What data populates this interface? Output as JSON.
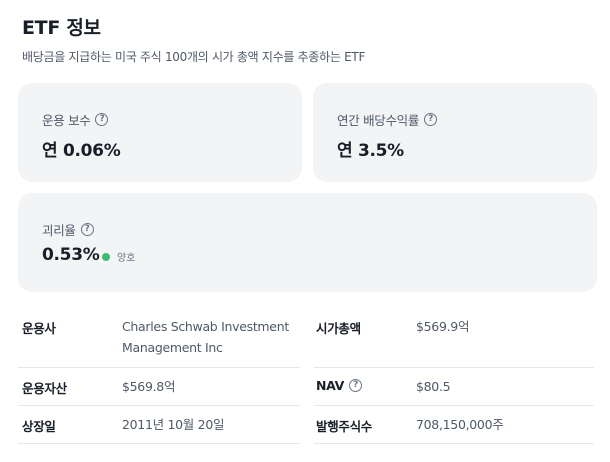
{
  "header": {
    "title": "ETF 정보",
    "subtitle": "배당금을 지급하는 미국 주식 100개의 시가 총액 지수를 추종하는 ETF"
  },
  "cards": {
    "fee": {
      "label": "운용 보수",
      "value": "연 0.06%"
    },
    "dividend": {
      "label": "연간 배당수익률",
      "value": "연 3.5%"
    },
    "premium": {
      "label": "괴리율",
      "value": "0.53%",
      "status": "양호",
      "status_color": "#3dbc74"
    }
  },
  "info": {
    "manager_label": "운용사",
    "manager_line1": "Charles Schwab Investment",
    "manager_line2": "Management Inc",
    "market_cap_label": "시가총액",
    "market_cap_value": "$569.9억",
    "aum_label": "운용자산",
    "aum_value": "$569.8억",
    "nav_label": "NAV",
    "nav_value": "$80.5",
    "listing_label": "상장일",
    "listing_value": "2011년 10월 20일",
    "shares_label": "발행주식수",
    "shares_value": "708,150,000주"
  },
  "icons": {
    "help": "question-circle-icon"
  },
  "colors": {
    "card_bg": "#f2f4f6",
    "text": "#191f28",
    "muted": "#4e5968",
    "good": "#3dbc74"
  }
}
